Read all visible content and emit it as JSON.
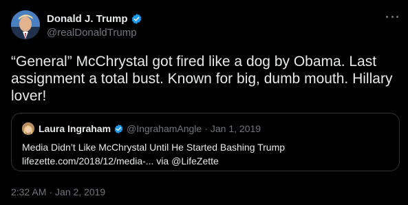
{
  "author": {
    "display_name": "Donald J. Trump",
    "handle": "@realDonaldTrump",
    "verified_icon": "verified-badge-icon"
  },
  "tweet": {
    "text": "“General” McChrystal got fired like a dog by Obama. Last assignment a total bust. Known for big, dumb mouth. Hillary lover!",
    "time": "2:32 AM",
    "date": "Jan 2, 2019",
    "separator": "·"
  },
  "quoted_tweet": {
    "display_name": "Laura Ingraham",
    "handle": "@IngrahamAngle",
    "separator": "·",
    "date": "Jan 1, 2019",
    "line1": "Media Didn’t Like McChrystal Until He Started Bashing Trump",
    "line2": "lifezette.com/2018/12/media-... via @LifeZette"
  },
  "colors": {
    "background": "#000000",
    "text_primary": "#e7e9ea",
    "text_secondary": "#71767b",
    "verified_blue": "#1d9bf0",
    "border": "#2f3336"
  },
  "icons": {
    "more": "more-options-icon",
    "avatar": "profile-avatar",
    "quote_avatar": "quoted-profile-avatar"
  }
}
